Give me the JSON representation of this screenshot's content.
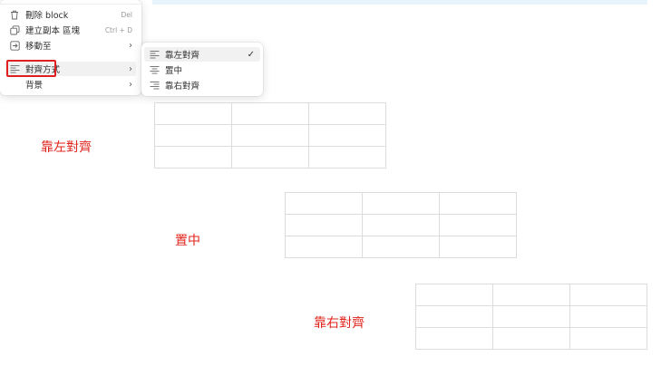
{
  "context_menu": {
    "items": [
      {
        "label": "刪除 block",
        "shortcut": "Del",
        "icon": "trash-icon"
      },
      {
        "label": "建立副本 區塊",
        "shortcut": "Ctrl + D",
        "icon": "copy-icon"
      },
      {
        "label": "移動至",
        "shortcut": "",
        "icon": "move-to-icon",
        "arrow": "›"
      },
      {
        "label": "對齊方式",
        "shortcut": "",
        "icon": "align-left-icon",
        "arrow": "›"
      },
      {
        "label": "背景",
        "shortcut": "",
        "icon": "",
        "arrow": "›"
      }
    ]
  },
  "alignment_submenu": {
    "items": [
      {
        "label": "靠左對齊",
        "icon": "align-left-icon",
        "checked": true,
        "check": "✓"
      },
      {
        "label": "置中",
        "icon": "align-center-icon",
        "checked": false
      },
      {
        "label": "靠右對齊",
        "icon": "align-right-icon",
        "checked": false
      }
    ]
  },
  "annotations": {
    "left": "靠左對齊",
    "center": "置中",
    "right": "靠右對齊"
  },
  "colors": {
    "annotation_red": "#e0241b",
    "highlight_border": "#e02020",
    "banner": "#e8f4fb"
  }
}
